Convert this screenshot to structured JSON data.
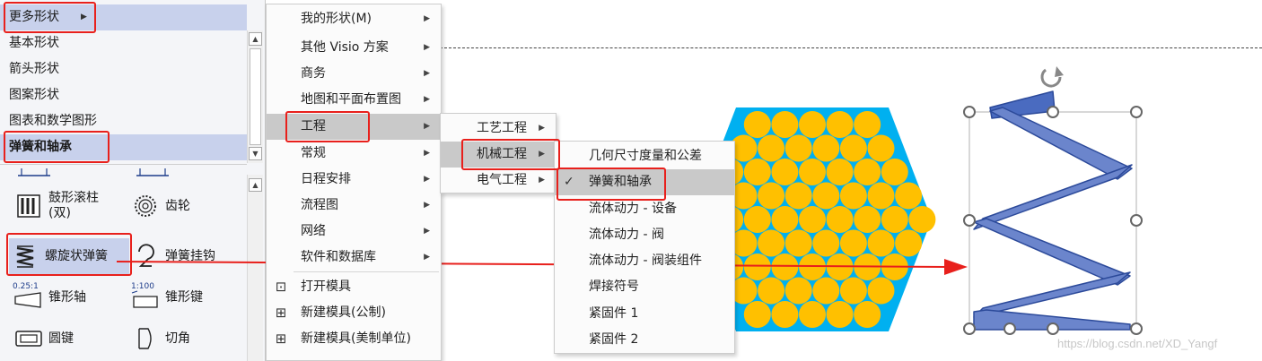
{
  "left_panel": {
    "categories": [
      {
        "label": "更多形状"
      },
      {
        "label": "基本形状"
      },
      {
        "label": "箭头形状"
      },
      {
        "label": "图案形状"
      },
      {
        "label": "图表和数学图形"
      },
      {
        "label": "弹簧和轴承"
      }
    ],
    "shapes": [
      {
        "label": "鼓形滚柱\n(双)"
      },
      {
        "label": "齿轮"
      },
      {
        "label": "螺旋状弹簧"
      },
      {
        "label": "弹簧挂钩"
      },
      {
        "label": "锥形轴"
      },
      {
        "label": "锥形键"
      },
      {
        "label": "圆键"
      },
      {
        "label": "切角"
      }
    ],
    "icon_texts": {
      "taper_ratio": "0.25:1",
      "taper_key_ratio": "1:100"
    }
  },
  "menu_main": {
    "items": [
      {
        "label": "我的形状(M)"
      },
      {
        "label": "其他 Visio 方案"
      },
      {
        "label": "商务"
      },
      {
        "label": "地图和平面布置图"
      },
      {
        "label": "工程"
      },
      {
        "label": "常规"
      },
      {
        "label": "日程安排"
      },
      {
        "label": "流程图"
      },
      {
        "label": "网络"
      },
      {
        "label": "软件和数据库"
      },
      {
        "label": "打开模具",
        "icon": "open-stencil-icon"
      },
      {
        "label": "新建模具(公制)",
        "icon": "new-stencil-icon"
      },
      {
        "label": "新建模具(美制单位)",
        "icon": "new-stencil-icon"
      }
    ]
  },
  "menu_engineering": {
    "items": [
      {
        "label": "工艺工程"
      },
      {
        "label": "机械工程"
      },
      {
        "label": "电气工程"
      }
    ]
  },
  "menu_mechanical": {
    "items": [
      {
        "label": "几何尺寸度量和公差"
      },
      {
        "label": "弹簧和轴承",
        "checked": true
      },
      {
        "label": "流体动力 - 设备"
      },
      {
        "label": "流体动力 - 阀"
      },
      {
        "label": "流体动力 - 阀装组件"
      },
      {
        "label": "焊接符号"
      },
      {
        "label": "紧固件 1"
      },
      {
        "label": "紧固件 2"
      }
    ]
  },
  "canvas": {
    "watermark": "https://blog.csdn.net/XD_Yangf"
  },
  "colors": {
    "highlight": "#c8d1ec",
    "menu_highlight": "#c9c9c9",
    "annotation_red": "#e8201c",
    "bearing_fill": "#ffc000",
    "bearing_bg": "#00b0f0",
    "spring_fill": "#5b7ac4"
  }
}
